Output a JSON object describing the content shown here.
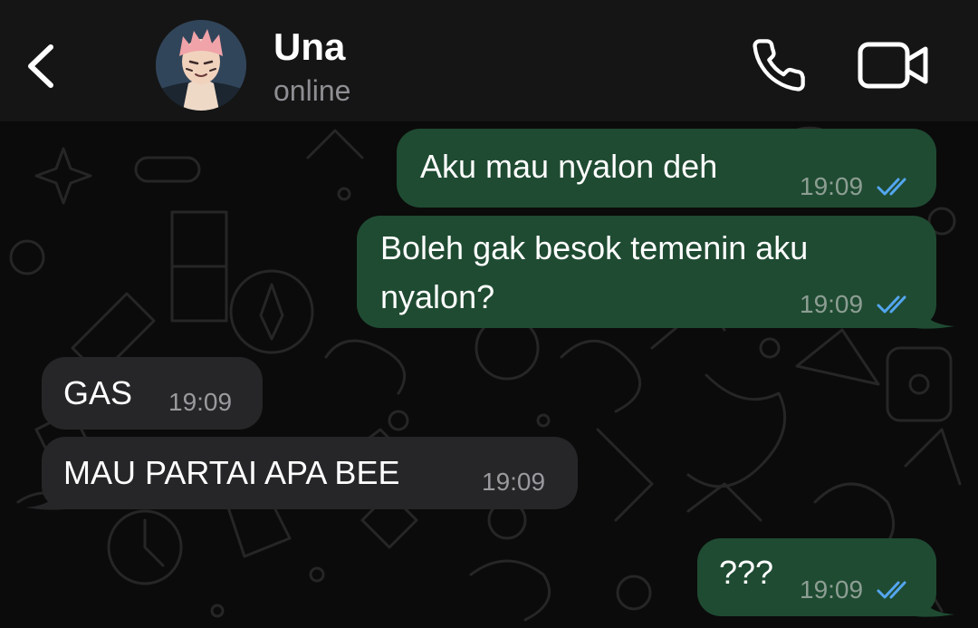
{
  "header": {
    "contact_name": "Una",
    "status": "online"
  },
  "messages": [
    {
      "direction": "outgoing",
      "lines": [
        "Aku mau nyalon deh"
      ],
      "time": "19:09",
      "read": true
    },
    {
      "direction": "outgoing",
      "lines": [
        "Boleh gak besok temenin aku",
        "nyalon?"
      ],
      "time": "19:09",
      "read": true
    },
    {
      "direction": "incoming",
      "lines": [
        "GAS"
      ],
      "time": "19:09"
    },
    {
      "direction": "incoming",
      "lines": [
        "MAU PARTAI APA BEE"
      ],
      "time": "19:09"
    },
    {
      "direction": "outgoing",
      "lines": [
        "???"
      ],
      "time": "19:09",
      "read": true
    }
  ],
  "icons": {
    "back": "chevron-left-icon",
    "call": "phone-icon",
    "video": "video-camera-icon",
    "read_receipt": "double-check-icon"
  },
  "colors": {
    "header_bg": "#151515",
    "chat_bg": "#0b0b0b",
    "outgoing_bubble": "#1f4b32",
    "incoming_bubble": "#262628",
    "read_ticks": "#53a6f0"
  }
}
